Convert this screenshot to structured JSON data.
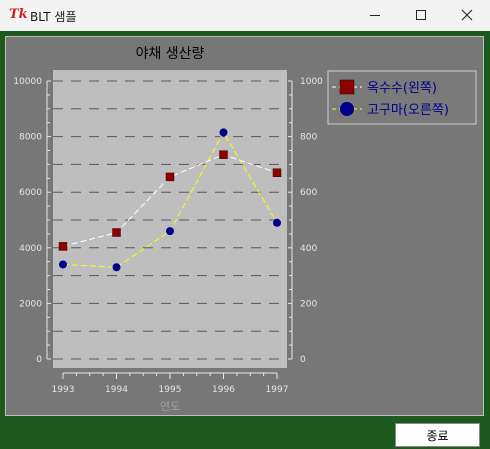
{
  "window": {
    "app_icon": "Tk",
    "title": "BLT 샘플",
    "buttons": [
      "minimize-icon",
      "maximize-icon",
      "close-icon"
    ]
  },
  "chart_data": {
    "type": "line",
    "title": "야채 생산량",
    "xlabel": "연도",
    "categories": [
      "1993",
      "1994",
      "1995",
      "1996",
      "1997"
    ],
    "x": [
      1993,
      1994,
      1995,
      1996,
      1997
    ],
    "y_left": {
      "ylim": [
        0,
        10000
      ],
      "ticks": [
        "0",
        "2000",
        "4000",
        "6000",
        "8000",
        "10000"
      ]
    },
    "y_right": {
      "ylim": [
        0,
        1000
      ],
      "ticks": [
        "0",
        "200",
        "400",
        "600",
        "800",
        "1000"
      ]
    },
    "grid": true,
    "legend_position": "right",
    "series": [
      {
        "name": "옥수수(왼쪽)",
        "axis": "left",
        "values": [
          4050,
          4550,
          6550,
          7350,
          6700
        ],
        "line_color": "#ffffff",
        "marker_color": "#8b0000",
        "marker": "square"
      },
      {
        "name": "고구마(오른쪽)",
        "axis": "right",
        "values": [
          340,
          330,
          460,
          815,
          490
        ],
        "line_color": "#ffff00",
        "marker_color": "#00008b",
        "marker": "circle"
      }
    ]
  },
  "footer": {
    "close_label": "종료"
  }
}
